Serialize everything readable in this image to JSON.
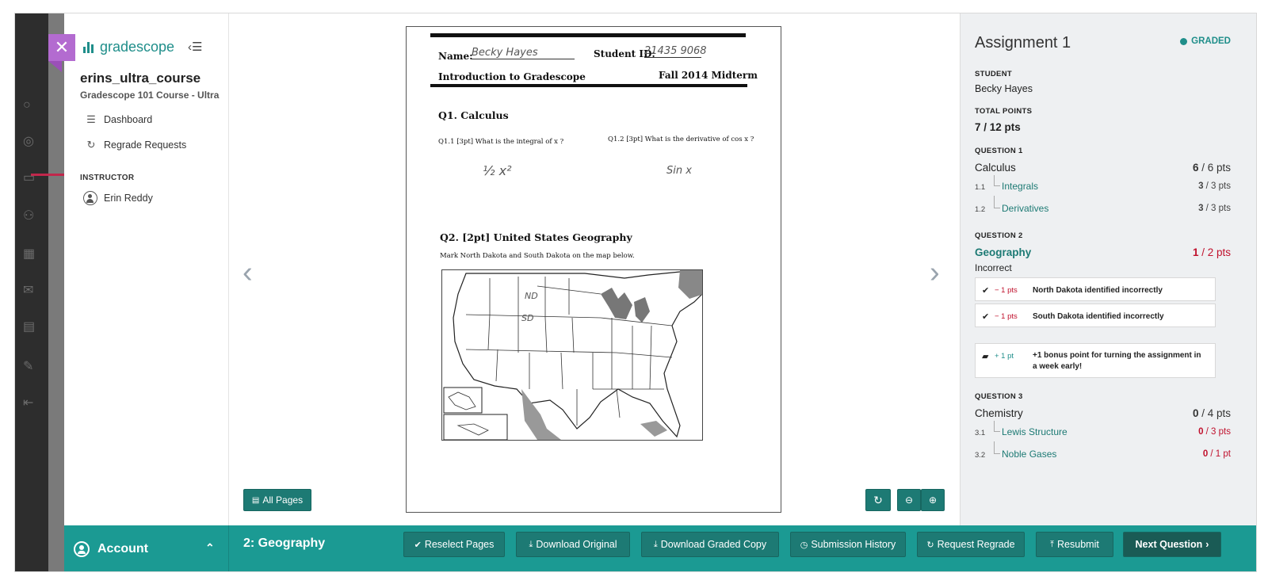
{
  "close": {
    "label": "✕"
  },
  "brand": {
    "name": "gradescope",
    "collapse_icon": "‹☰"
  },
  "course": {
    "title": "erins_ultra_course",
    "subtitle": "Gradescope 101 Course - Ultra"
  },
  "nav": [
    {
      "icon": "dashboard-icon",
      "glyph": "☰",
      "label": "Dashboard"
    },
    {
      "icon": "regrade-icon",
      "glyph": "↻",
      "label": "Regrade Requests"
    }
  ],
  "instructor": {
    "label": "INSTRUCTOR",
    "name": "Erin Reddy"
  },
  "viewer": {
    "prev": "‹",
    "next": "›",
    "all_pages": "All Pages"
  },
  "page": {
    "name_label": "Name:",
    "name_value": "Becky Hayes",
    "student_id_label": "Student ID:",
    "student_id_value": "21435 9068",
    "course_line": "Introduction to Gradescope",
    "exam_line": "Fall 2014 Midterm",
    "q1_title": "Q1.  Calculus",
    "q11": "Q1.1  [3pt] What is the integral of x ?",
    "q12": "Q1.2  [3pt]  What is the derivative of  cos x ?",
    "a11": "½ x²",
    "a12": "Sin x",
    "q2_title": "Q2.  [2pt] United States Geography",
    "q2_text": "Mark North Dakota and South Dakota on the map below.",
    "nd": "ND",
    "sd": "SD"
  },
  "panel": {
    "title": "Assignment 1",
    "status": "GRADED",
    "student_label": "STUDENT",
    "student": "Becky Hayes",
    "total_label": "TOTAL POINTS",
    "total": "7 / 12 pts",
    "q1": {
      "label": "QUESTION 1",
      "name": "Calculus",
      "score": "6",
      "of": " / 6 pts",
      "subs": [
        {
          "num": "1.1",
          "name": "Integrals",
          "score": "3",
          "of": " / 3 pts"
        },
        {
          "num": "1.2",
          "name": "Derivatives",
          "score": "3",
          "of": " / 3 pts"
        }
      ]
    },
    "q2": {
      "label": "QUESTION 2",
      "name": "Geography",
      "score": "1",
      "of": " / 2 pts",
      "status": "Incorrect",
      "rubric": [
        {
          "pts": "− 1 pts",
          "text": "North Dakota identified incorrectly"
        },
        {
          "pts": "− 1 pts",
          "text": "South Dakota identified incorrectly"
        }
      ],
      "comment": {
        "pts": "+ 1 pt",
        "text": "+1 bonus point for turning the assignment in a week early!"
      }
    },
    "q3": {
      "label": "QUESTION 3",
      "name": "Chemistry",
      "score": "0",
      "of": " / 4 pts",
      "subs": [
        {
          "num": "3.1",
          "name": "Lewis Structure",
          "score": "0",
          "of": " / 3 pts"
        },
        {
          "num": "3.2",
          "name": "Noble Gases",
          "score": "0",
          "of": " / 1 pt"
        }
      ]
    }
  },
  "bottom": {
    "account": "Account",
    "question": "2: Geography",
    "buttons": {
      "reselect": "Reselect Pages",
      "download_original": "Download Original",
      "download_graded": "Download Graded Copy",
      "history": "Submission History",
      "regrade": "Request Regrade",
      "resubmit": "Resubmit",
      "next": "Next Question"
    }
  },
  "colors": {
    "teal": "#1b9a93",
    "dark_teal": "#1d7a74",
    "red": "#c0112d",
    "purple": "#b36bd0"
  }
}
